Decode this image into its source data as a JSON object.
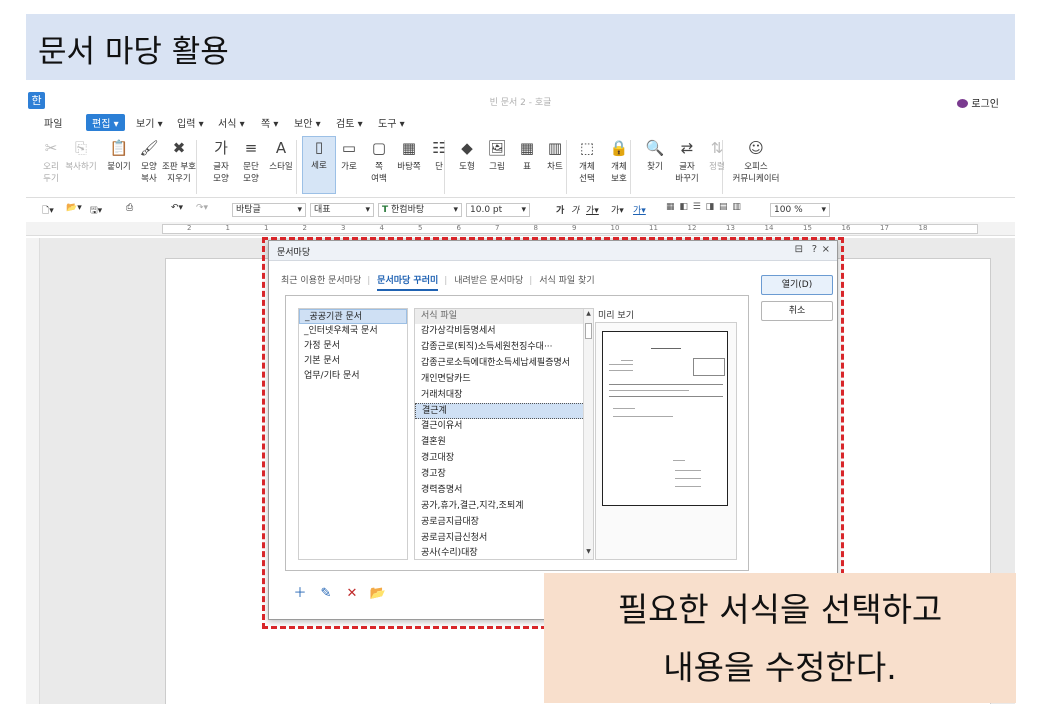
{
  "slide": {
    "title": "문서 마당 활용",
    "callout_line1": "필요한 서식을 선택하고",
    "callout_line2": "내용을 수정한다."
  },
  "app": {
    "logo": "한",
    "window_title": "빈 문서 2 - 호글",
    "login": "로그인",
    "menu": [
      "파일",
      "편집",
      "보기",
      "입력",
      "서식",
      "쪽",
      "보안",
      "검토",
      "도구"
    ],
    "active_menu": "편집"
  },
  "ribbon": [
    {
      "label": "오리\n두기",
      "icon": "scissors-icon",
      "disabled": true
    },
    {
      "label": "복사하기",
      "icon": "copy-icon",
      "disabled": true
    },
    {
      "label": "붙이기",
      "icon": "paste-icon"
    },
    {
      "label": "모양\n복사",
      "icon": "format-painter-icon"
    },
    {
      "label": "조판 부호\n지우기",
      "icon": "clear-codes-icon"
    },
    {
      "label": "글자\n모양",
      "icon": "char-shape-icon"
    },
    {
      "label": "문단\n모양",
      "icon": "para-shape-icon"
    },
    {
      "label": "스타일",
      "icon": "style-icon"
    },
    {
      "label": "세로",
      "icon": "portrait-icon",
      "selected": true
    },
    {
      "label": "가로",
      "icon": "landscape-icon"
    },
    {
      "label": "쪽\n여백",
      "icon": "margin-icon"
    },
    {
      "label": "바탕쪽",
      "icon": "master-page-icon"
    },
    {
      "label": "단",
      "icon": "columns-icon"
    },
    {
      "label": "도형",
      "icon": "shape-icon"
    },
    {
      "label": "그림",
      "icon": "picture-icon"
    },
    {
      "label": "표",
      "icon": "table-icon"
    },
    {
      "label": "차트",
      "icon": "chart-icon"
    },
    {
      "label": "개체\n선택",
      "icon": "select-object-icon"
    },
    {
      "label": "개체\n보호",
      "icon": "protect-object-icon"
    },
    {
      "label": "찾기",
      "icon": "find-icon"
    },
    {
      "label": "글자\n바꾸기",
      "icon": "replace-icon"
    },
    {
      "label": "정렬",
      "icon": "sort-icon",
      "disabled": true
    },
    {
      "label": "오피스\n커뮤니케이터",
      "icon": "communicator-icon"
    }
  ],
  "toolbar": {
    "style": "바탕글",
    "lang": "대표",
    "font": "한컴바탕",
    "size": "10.0",
    "unit": "pt",
    "zoom": "100",
    "zoom_unit": "%"
  },
  "ruler_marks": [
    "2",
    "1",
    "1",
    "2",
    "3",
    "4",
    "5",
    "6",
    "7",
    "8",
    "9",
    "10",
    "11",
    "12",
    "13",
    "14",
    "15",
    "16",
    "17",
    "18"
  ],
  "dialog": {
    "title": "문서마당",
    "help": "?",
    "close": "×",
    "tabs": [
      "최근 이용한 문서마당",
      "문서마당 꾸러미",
      "내려받은 문서마당",
      "서식 파일 찾기"
    ],
    "active_tab": 1,
    "categories": [
      "_공공기관 문서",
      "_인터넷우체국 문서",
      "가정 문서",
      "기본 문서",
      "업무/기타 문서"
    ],
    "selected_category": 0,
    "file_header": "서식 파일",
    "files": [
      "감가상각비등명세서",
      "갑종근로(퇴직)소득세원천징수대···",
      "갑종근로소득에대한소득세납세필증명서",
      "개인면담카드",
      "거래처대장",
      "결근계",
      "결근이유서",
      "결혼원",
      "경고대장",
      "경고장",
      "경력증명서",
      "공가,휴가,결근,지각,조퇴계",
      "공로금지급대장",
      "공로금지급신청서",
      "공사(수리)대장"
    ],
    "selected_file": 5,
    "preview_label": "미리 보기",
    "open_button": "열기(D)",
    "cancel_button": "취소"
  }
}
